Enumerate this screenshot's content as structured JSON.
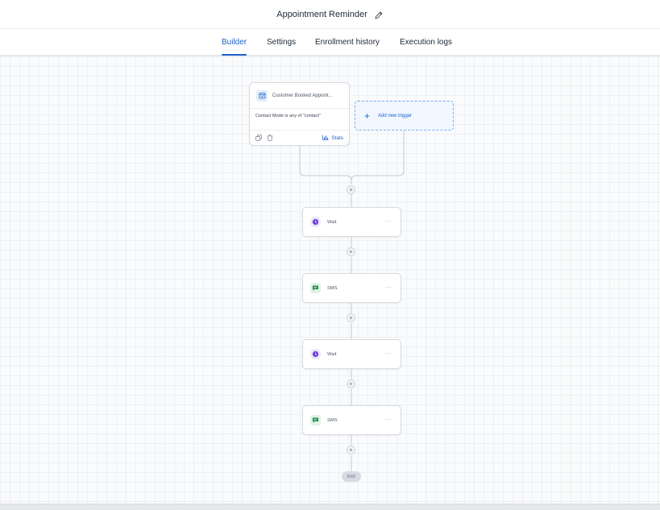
{
  "header": {
    "title": "Appointment Reminder",
    "edit_icon": "pencil-icon"
  },
  "tabs": [
    {
      "label": "Builder",
      "active": true
    },
    {
      "label": "Settings",
      "active": false
    },
    {
      "label": "Enrollment history",
      "active": false
    },
    {
      "label": "Execution logs",
      "active": false
    }
  ],
  "trigger": {
    "icon": "calendar-check-icon",
    "title": "Customer Booked Appoint...",
    "condition": "Contact Mode is any of \"contact\"",
    "stats_label": "Stats",
    "footer_icons": [
      "copy-icon",
      "trash-icon",
      "bar-chart-icon"
    ]
  },
  "add_trigger": {
    "label": "Add new trigger"
  },
  "steps": [
    {
      "type": "wait",
      "label": "Wait",
      "icon": "clock-icon",
      "more": "···"
    },
    {
      "type": "sms",
      "label": "SMS",
      "icon": "message-icon",
      "more": "···"
    },
    {
      "type": "wait",
      "label": "Wait",
      "icon": "clock-icon",
      "more": "···"
    },
    {
      "type": "sms",
      "label": "SMS",
      "icon": "message-icon",
      "more": "···"
    }
  ],
  "add_step_symbol": "+",
  "end_label": "END",
  "colors": {
    "accent": "#1d62c9",
    "wait_icon": "#6d3fd6",
    "sms_icon": "#1a8a4a"
  }
}
